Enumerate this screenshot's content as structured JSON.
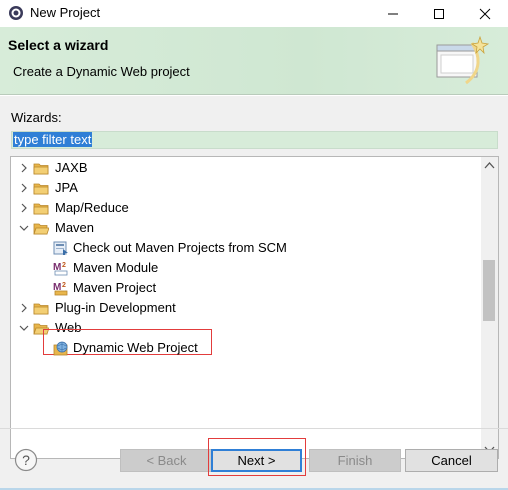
{
  "window": {
    "title": "New Project",
    "icon": "eclipse-gear-icon",
    "controls": [
      "minimize-icon",
      "maximize-icon",
      "close-icon"
    ]
  },
  "header": {
    "title": "Select a wizard",
    "description": "Create a Dynamic Web project",
    "banner_icon": "wizard-banner-icon",
    "background_color": "#d7ecd9"
  },
  "wizards": {
    "label": "Wizards:",
    "filter_value": "type filter text",
    "tree": [
      {
        "label": "JAXB",
        "type": "folder",
        "state": "collapsed",
        "level": 0
      },
      {
        "label": "JPA",
        "type": "folder",
        "state": "collapsed",
        "level": 0
      },
      {
        "label": "Map/Reduce",
        "type": "folder",
        "state": "collapsed",
        "level": 0
      },
      {
        "label": "Maven",
        "type": "folder",
        "state": "expanded",
        "level": 0
      },
      {
        "label": "Check out Maven Projects from SCM",
        "type": "leaf",
        "icon": "scm-checkout-icon",
        "level": 1
      },
      {
        "label": "Maven Module",
        "type": "leaf",
        "icon": "maven-module-icon",
        "level": 1
      },
      {
        "label": "Maven Project",
        "type": "leaf",
        "icon": "maven-project-icon",
        "level": 1
      },
      {
        "label": "Plug-in Development",
        "type": "folder",
        "state": "collapsed",
        "level": 0
      },
      {
        "label": "Web",
        "type": "folder",
        "state": "expanded",
        "level": 0
      },
      {
        "label": "Dynamic Web Project",
        "type": "leaf",
        "icon": "web-project-icon",
        "level": 1,
        "selected": true
      }
    ]
  },
  "buttons": {
    "back": "< Back",
    "next": "Next >",
    "finish": "Finish",
    "cancel": "Cancel",
    "help_icon": "help-icon"
  },
  "colors": {
    "accent": "#2f7fd6",
    "highlight": "#e23c3c",
    "folder": "#e8b64c"
  }
}
